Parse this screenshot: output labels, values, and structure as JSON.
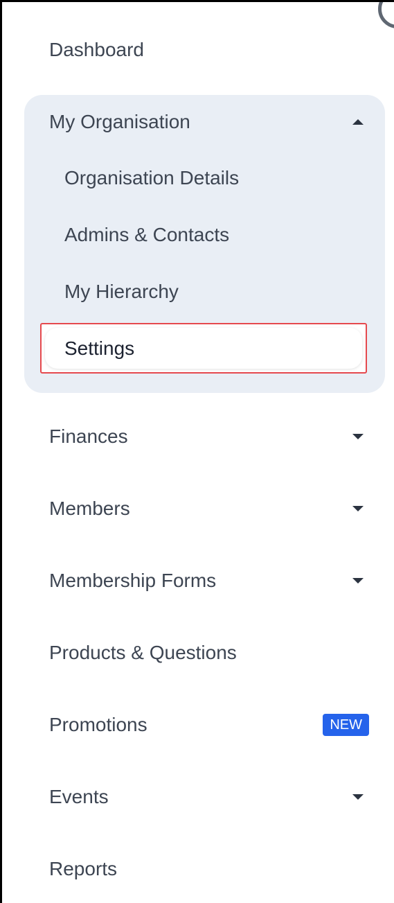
{
  "sidebar": {
    "dashboard": "Dashboard",
    "my_organisation": {
      "label": "My Organisation",
      "expanded": true,
      "children": {
        "organisation_details": "Organisation Details",
        "admins_contacts": "Admins & Contacts",
        "my_hierarchy": "My Hierarchy",
        "settings": "Settings"
      }
    },
    "finances": "Finances",
    "members": "Members",
    "membership_forms": "Membership Forms",
    "products_questions": "Products & Questions",
    "promotions": {
      "label": "Promotions",
      "badge": "NEW"
    },
    "events": "Events",
    "reports": "Reports"
  },
  "colors": {
    "text": "#3d4552",
    "group_background": "#e9eef5",
    "highlight_outline": "#e5484d",
    "badge_background": "#2563eb"
  },
  "icons": {
    "collapse": "chevron-up-icon",
    "expand": "chevron-down-icon",
    "loading": "spinner-icon"
  }
}
